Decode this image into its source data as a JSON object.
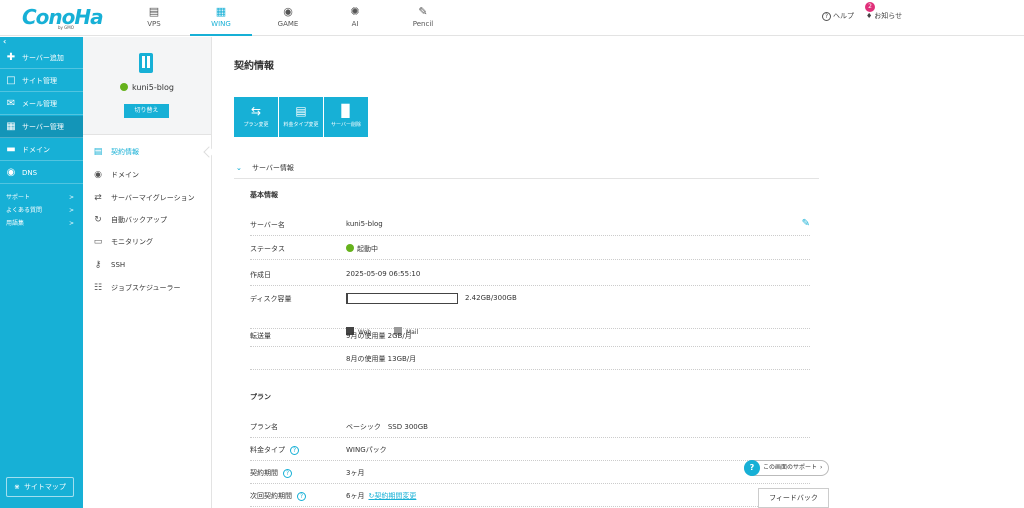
{
  "brand": {
    "logo_text": "ConoHa",
    "logo_sub": "by GMO"
  },
  "top_nav": [
    {
      "label": "VPS",
      "icon": "server-icon"
    },
    {
      "label": "WING",
      "icon": "wing-icon",
      "active": true
    },
    {
      "label": "GAME",
      "icon": "gamepad-icon"
    },
    {
      "label": "AI",
      "icon": "ai-icon"
    },
    {
      "label": "Pencil",
      "icon": "pencil-icon"
    }
  ],
  "header": {
    "help_label": "ヘルプ",
    "notice_label": "お知らせ",
    "notice_count": "2"
  },
  "left_nav": {
    "items": [
      {
        "label": "サーバー追加",
        "icon": "plus-icon"
      },
      {
        "label": "サイト管理",
        "icon": "site-icon"
      },
      {
        "label": "メール管理",
        "icon": "mail-icon"
      },
      {
        "label": "サーバー管理",
        "icon": "server-icon",
        "active": true
      },
      {
        "label": "ドメイン",
        "icon": "domain-icon"
      },
      {
        "label": "DNS",
        "icon": "globe-icon"
      }
    ],
    "sub_links": [
      {
        "label": "サポート",
        "arrow": ">"
      },
      {
        "label": "よくある質問",
        "arrow": ">"
      },
      {
        "label": "用語集",
        "arrow": ">"
      }
    ],
    "sitemap_label": "サイトマップ"
  },
  "server_card": {
    "name": "kuni5-blog",
    "switch_label": "切り替え"
  },
  "sub_nav": [
    {
      "label": "契約情報",
      "icon": "contract-icon",
      "active": true
    },
    {
      "label": "ドメイン",
      "icon": "globe-icon"
    },
    {
      "label": "サーバーマイグレーション",
      "icon": "migration-icon"
    },
    {
      "label": "自動バックアップ",
      "icon": "backup-icon"
    },
    {
      "label": "モニタリング",
      "icon": "monitor-icon"
    },
    {
      "label": "SSH",
      "icon": "key-icon"
    },
    {
      "label": "ジョブスケジューラー",
      "icon": "scheduler-icon"
    }
  ],
  "main": {
    "title": "契約情報",
    "actions": [
      {
        "label": "プラン変更",
        "icon": "swap-icon"
      },
      {
        "label": "料金タイプ変更",
        "icon": "price-icon"
      },
      {
        "label": "サーバー削除",
        "icon": "trash-icon"
      }
    ],
    "section_header": "サーバー情報",
    "basic": {
      "title": "基本情報",
      "server_name_label": "サーバー名",
      "server_name_value": "kuni5-blog",
      "status_label": "ステータス",
      "status_value": "起動中",
      "created_label": "作成日",
      "created_value": "2025-05-09 06:55:10",
      "disk_label": "ディスク容量",
      "disk_text": "2.42GB/300GB",
      "disk_usage_fraction": 0.008,
      "legend_web": "Web",
      "legend_mail": "Mail",
      "transfer_label": "転送量",
      "transfer_sep": "9月の使用量 2GB/月",
      "transfer_aug": "8月の使用量 13GB/月"
    },
    "plan": {
      "title": "プラン",
      "plan_name_label": "プラン名",
      "plan_name_value": "ベーシック　SSD 300GB",
      "price_type_label": "料金タイプ",
      "price_type_value": "WINGパック",
      "period_label": "契約期間",
      "period_value": "3ヶ月",
      "next_period_label": "次回契約期間",
      "next_period_value": "6ヶ月",
      "next_period_link": "契約期間変更"
    }
  },
  "floating": {
    "support_label": "この画面のサポート",
    "feedback_label": "フィードバック"
  },
  "colors": {
    "accent": "#17b0d6",
    "status_ok": "#66b21c",
    "badge": "#e0307a",
    "disk_web": "#444444",
    "disk_mail": "#999999"
  }
}
